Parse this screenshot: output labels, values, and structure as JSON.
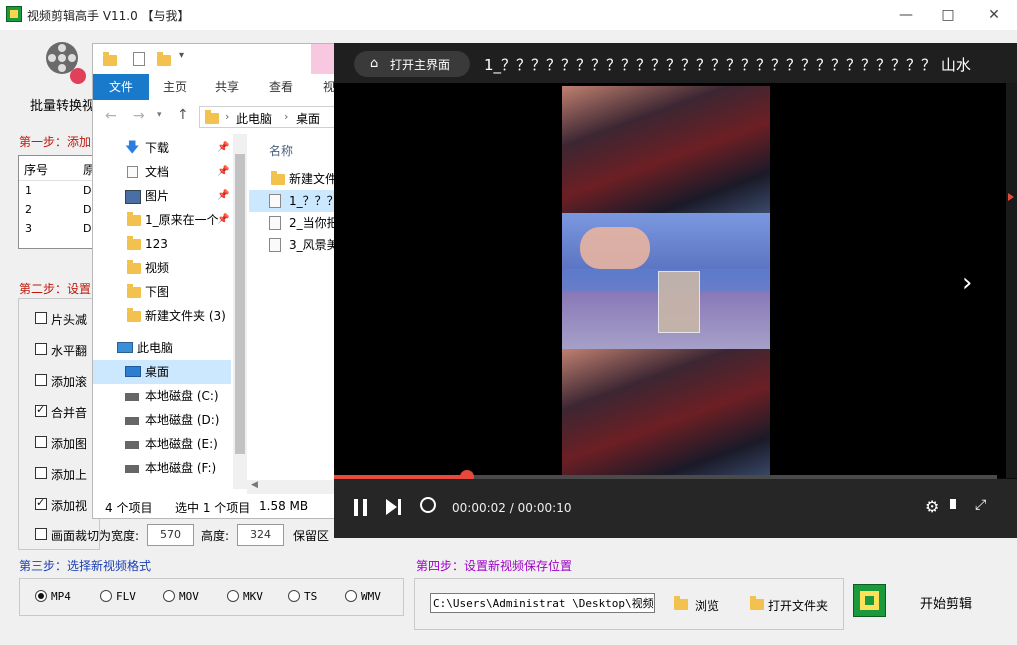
{
  "app": {
    "title": "视频剪辑高手 V11.0  【与我】",
    "toolbar": {
      "batch_label": "批量转换视"
    },
    "step1": {
      "title": "第一步：添加"
    },
    "table": {
      "headers": [
        "序号",
        "原"
      ],
      "rows": [
        [
          "1",
          "D"
        ],
        [
          "2",
          "D"
        ],
        [
          "3",
          "D"
        ]
      ]
    },
    "step2": {
      "title": "第二步：设置"
    },
    "options": [
      {
        "label": "片头减",
        "checked": false
      },
      {
        "label": "水平翻",
        "checked": false
      },
      {
        "label": "添加滚",
        "checked": false
      },
      {
        "label": "合并音",
        "checked": true
      },
      {
        "label": "添加图",
        "checked": false
      },
      {
        "label": "添加上",
        "checked": false
      },
      {
        "label": "添加视",
        "checked": true
      }
    ],
    "crop": {
      "label": "画面裁切为宽度:",
      "width": "570",
      "height_label": "高度:",
      "height": "324",
      "keep_label": "保留区"
    },
    "step3": {
      "title": "第三步：选择新视频格式",
      "formats": [
        "MP4",
        "FLV",
        "MOV",
        "MKV",
        "TS",
        "WMV"
      ],
      "selected": "MP4"
    },
    "step4": {
      "title": "第四步：设置新视频保存位置",
      "path": "C:\\Users\\Administrat  \\Desktop\\视频",
      "browse_label": "浏览",
      "open_folder_label": "打开文件夹"
    },
    "start_label": "开始剪辑",
    "colors": {
      "step_red": "#c0180c",
      "step_blue": "#1a3fb3",
      "step_purple": "#a000c8",
      "brand_green": "#1a9a3a"
    }
  },
  "explorer": {
    "ribbon_tabs": [
      "文件",
      "主页",
      "共享",
      "查看",
      "视"
    ],
    "breadcrumb": [
      "此电脑",
      "桌面"
    ],
    "nav_items": [
      {
        "label": "下载",
        "icon": "download-icon",
        "pinned": true
      },
      {
        "label": "文档",
        "icon": "document-icon",
        "pinned": true
      },
      {
        "label": "图片",
        "icon": "picture-icon",
        "pinned": true
      },
      {
        "label": "1_原来在一个",
        "icon": "folder-icon",
        "pinned": true
      },
      {
        "label": "123",
        "icon": "folder-icon",
        "pinned": false
      },
      {
        "label": "视频",
        "icon": "folder-icon",
        "pinned": false
      },
      {
        "label": "下图",
        "icon": "folder-icon",
        "pinned": false
      },
      {
        "label": "新建文件夹 (3)",
        "icon": "folder-icon",
        "pinned": false
      },
      {
        "label": "此电脑",
        "icon": "computer-icon",
        "pinned": false
      },
      {
        "label": "桌面",
        "icon": "desktop-icon",
        "pinned": false,
        "selected": true
      },
      {
        "label": "本地磁盘 (C:)",
        "icon": "drive-icon",
        "pinned": false
      },
      {
        "label": "本地磁盘 (D:)",
        "icon": "drive-icon",
        "pinned": false
      },
      {
        "label": "本地磁盘 (E:)",
        "icon": "drive-icon",
        "pinned": false
      },
      {
        "label": "本地磁盘 (F:)",
        "icon": "drive-icon",
        "pinned": false
      }
    ],
    "column_header": "名称",
    "files": [
      {
        "name": "新建文件",
        "type": "folder"
      },
      {
        "name": "1_？？？",
        "type": "video",
        "selected": true
      },
      {
        "name": "2_当你把",
        "type": "video"
      },
      {
        "name": "3_风景美",
        "type": "video"
      }
    ],
    "status": {
      "count": "4 个项目",
      "selection": "选中 1 个项目",
      "size": "1.58 MB"
    }
  },
  "player": {
    "home_label": "打开主界面",
    "filename": "1_？？？？？？？？？？？？？？？？？？？？？？？？？？？？？ 山水",
    "time": "00:00:02 / 00:00:10",
    "progress": 0.2
  }
}
